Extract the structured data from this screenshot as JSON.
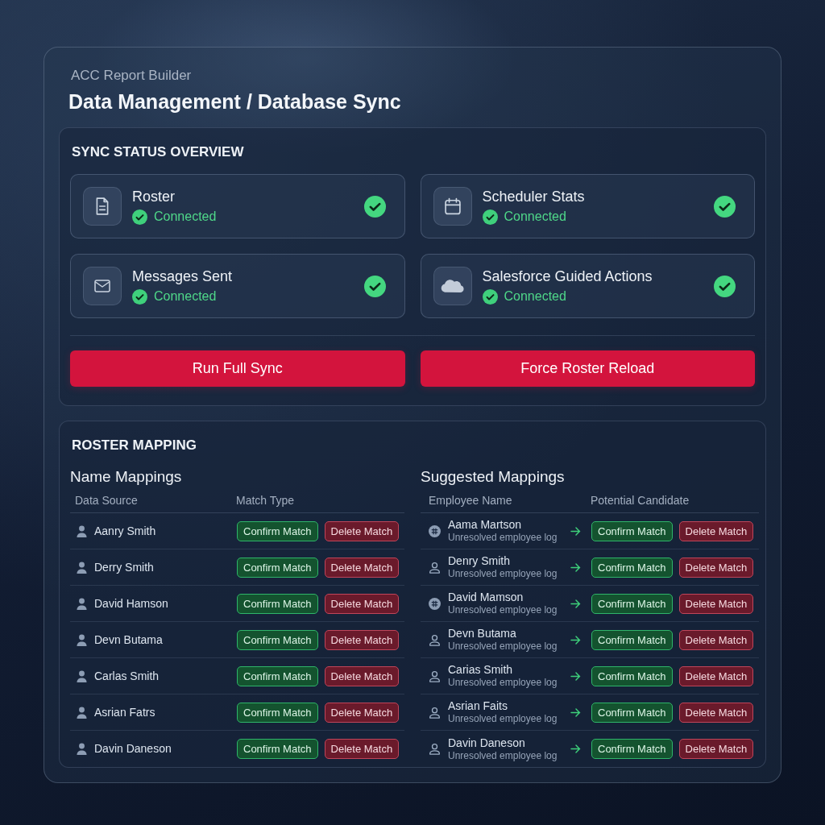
{
  "app": {
    "name": "ACC Report Builder",
    "title": "Data Management / Database Sync"
  },
  "sync_status": {
    "title": "SYNC STATUS OVERVIEW",
    "sources": [
      {
        "name": "Roster",
        "kind": "document",
        "connected": true,
        "status": "Connected"
      },
      {
        "name": "Scheduler Stats",
        "kind": "calendar",
        "connected": true,
        "status": "Connected"
      },
      {
        "name": "Messages Sent",
        "kind": "mail",
        "connected": true,
        "status": "Connected"
      },
      {
        "name": "Salesforce Guided Actions",
        "kind": "cloud",
        "connected": true,
        "status": "Connected"
      }
    ],
    "actions": [
      "Run Full Sync",
      "Force Roster Reload"
    ]
  },
  "roster_mapping": {
    "title": "ROSTER MAPPING",
    "name_mappings": {
      "title": "Name Mappings",
      "columns": [
        "Data Source",
        "Match Type"
      ],
      "rows": [
        {
          "name": "Aanry Smith",
          "confirm": "Confirm Match",
          "delete": "Delete Match"
        },
        {
          "name": "Derry Smith",
          "confirm": "Confirm Match",
          "delete": "Delete Match"
        },
        {
          "name": "David Hamson",
          "confirm": "Confirm Match",
          "delete": "Delete Match"
        },
        {
          "name": "Devn Butama",
          "confirm": "Confirm Match",
          "delete": "Delete Match"
        },
        {
          "name": "Carlas Smith",
          "confirm": "Confirm Match",
          "delete": "Delete Match"
        },
        {
          "name": "Asrian Fatrs",
          "confirm": "Confirm Match",
          "delete": "Delete Match"
        },
        {
          "name": "Davin Daneson",
          "confirm": "Confirm Match",
          "delete": "Delete Match"
        }
      ]
    },
    "suggested_mappings": {
      "title": "Suggested Mappings",
      "columns": [
        "Employee Name",
        "Potential Candidate"
      ],
      "rows": [
        {
          "name": "Aama Martson",
          "note": "Unresolved employee log",
          "kind": "record",
          "confirm": "Confirm Match",
          "delete": "Delete Match"
        },
        {
          "name": "Denry Smith",
          "note": "Unresolved employee log",
          "kind": "person",
          "confirm": "Confirm Match",
          "delete": "Delete Match"
        },
        {
          "name": "David Mamson",
          "note": "Unresolved employee log",
          "kind": "record",
          "confirm": "Confirm Match",
          "delete": "Delete Match"
        },
        {
          "name": "Devn Butama",
          "note": "Unresolved employee log",
          "kind": "person",
          "confirm": "Confirm Match",
          "delete": "Delete Match"
        },
        {
          "name": "Carias Smith",
          "note": "Unresolved employee log",
          "kind": "person",
          "confirm": "Confirm Match",
          "delete": "Delete Match"
        },
        {
          "name": "Asrian Faits",
          "note": "Unresolved employee log",
          "kind": "person",
          "confirm": "Confirm Match",
          "delete": "Delete Match"
        },
        {
          "name": "Davin Daneson",
          "note": "Unresolved employee log",
          "kind": "person",
          "confirm": "Confirm Match",
          "delete": "Delete Match"
        }
      ]
    }
  }
}
